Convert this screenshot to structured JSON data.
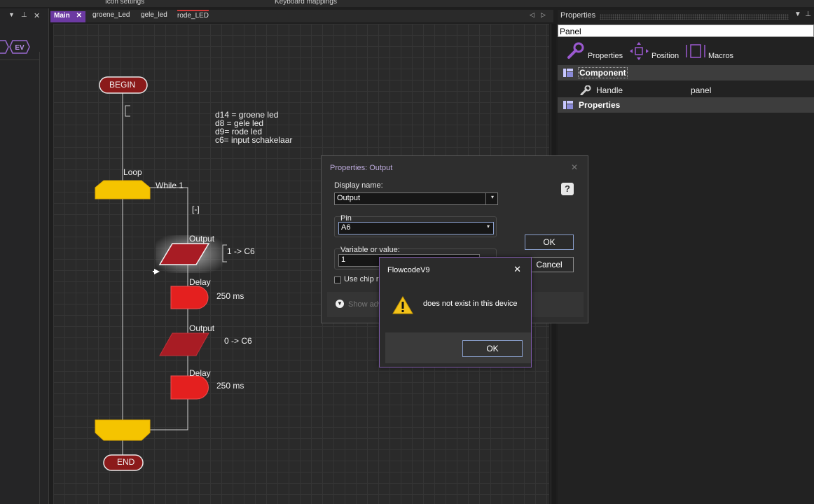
{
  "top_strip": {
    "items": [
      "Icon settings",
      "Keyboard mappings"
    ]
  },
  "left_panel": {
    "badge": "EV"
  },
  "tabs": [
    {
      "label": "Main",
      "active": true,
      "close": "✕"
    },
    {
      "label": "groene_Led"
    },
    {
      "label": "gele_led"
    },
    {
      "label": "rode_LED"
    }
  ],
  "tab_nav": {
    "left": "◁",
    "right": "▷"
  },
  "flowchart": {
    "begin": "BEGIN",
    "end": "END",
    "loop_label": "Loop",
    "loop_condition": "While 1",
    "collapse_marker": "[-]",
    "blocks": [
      {
        "kind": "output",
        "label": "Output",
        "detail": "1 -> C6"
      },
      {
        "kind": "delay",
        "label": "Delay",
        "detail": "250 ms"
      },
      {
        "kind": "output",
        "label": "Output",
        "detail": "0 -> C6"
      },
      {
        "kind": "delay",
        "label": "Delay",
        "detail": "250 ms"
      }
    ],
    "comment_lines": [
      "d14 = groene led",
      "d8 = gele led",
      "d9= rode led",
      "c6= input schakelaar"
    ]
  },
  "properties_panel": {
    "title": "Properties",
    "search_value": "Panel",
    "tools": [
      "Properties",
      "Position",
      "Macros"
    ],
    "sections": [
      {
        "label": "Component",
        "rows": [
          {
            "name": "Handle",
            "value": "panel"
          }
        ]
      },
      {
        "label": "Properties",
        "rows": []
      }
    ]
  },
  "output_dialog": {
    "title": "Properties: Output",
    "display_name_label": "Display name:",
    "display_name_value": "Output",
    "pin_label": "Pin",
    "pin_value": "A6",
    "variable_label": "Variable or value:",
    "variable_value": "1",
    "use_chip_label": "Use chip re",
    "show_advanced_label": "Show adv",
    "ok_label": "OK",
    "cancel_label": "Cancel",
    "help_icon": "?"
  },
  "message_box": {
    "title": "FlowcodeV9",
    "close": "✕",
    "message": "does not exist in this device",
    "ok_label": "OK"
  },
  "colors": {
    "accent_purple": "#6c3aa2",
    "terminal_red": "#8b1a1a",
    "loop_yellow": "#f5c400",
    "output_red": "#a81c24",
    "delay_red": "#e4201f"
  }
}
